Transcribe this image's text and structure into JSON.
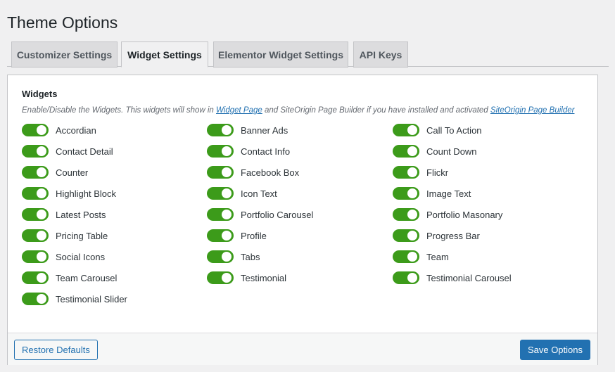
{
  "page": {
    "title": "Theme Options"
  },
  "tabs": [
    {
      "label": "Customizer Settings",
      "active": false
    },
    {
      "label": "Widget Settings",
      "active": true
    },
    {
      "label": "Elementor Widget Settings",
      "active": false
    },
    {
      "label": "API Keys",
      "active": false
    }
  ],
  "section": {
    "title": "Widgets",
    "description_pre": "Enable/Disable the Widgets. This widgets will show in ",
    "link_widget_page": "Widget Page",
    "description_mid": " and SiteOrigin Page Builder if you have installed and activated ",
    "link_siteorigin": "SiteOrigin Page Builder"
  },
  "widgets": {
    "col1": [
      {
        "label": "Accordian",
        "enabled": true
      },
      {
        "label": "Contact Detail",
        "enabled": true
      },
      {
        "label": "Counter",
        "enabled": true
      },
      {
        "label": "Highlight Block",
        "enabled": true
      },
      {
        "label": "Latest Posts",
        "enabled": true
      },
      {
        "label": "Pricing Table",
        "enabled": true
      },
      {
        "label": "Social Icons",
        "enabled": true
      },
      {
        "label": "Team Carousel",
        "enabled": true
      },
      {
        "label": "Testimonial Slider",
        "enabled": true
      }
    ],
    "col2": [
      {
        "label": "Banner Ads",
        "enabled": true
      },
      {
        "label": "Contact Info",
        "enabled": true
      },
      {
        "label": "Facebook Box",
        "enabled": true
      },
      {
        "label": "Icon Text",
        "enabled": true
      },
      {
        "label": "Portfolio Carousel",
        "enabled": true
      },
      {
        "label": "Profile",
        "enabled": true
      },
      {
        "label": "Tabs",
        "enabled": true
      },
      {
        "label": "Testimonial",
        "enabled": true
      }
    ],
    "col3": [
      {
        "label": "Call To Action",
        "enabled": true
      },
      {
        "label": "Count Down",
        "enabled": true
      },
      {
        "label": "Flickr",
        "enabled": true
      },
      {
        "label": "Image Text",
        "enabled": true
      },
      {
        "label": "Portfolio Masonary",
        "enabled": true
      },
      {
        "label": "Progress Bar",
        "enabled": true
      },
      {
        "label": "Team",
        "enabled": true
      },
      {
        "label": "Testimonial Carousel",
        "enabled": true
      }
    ]
  },
  "footer": {
    "restore_label": "Restore Defaults",
    "save_label": "Save Options"
  },
  "colors": {
    "toggle_on": "#3c9b1a",
    "primary": "#2271b1"
  }
}
